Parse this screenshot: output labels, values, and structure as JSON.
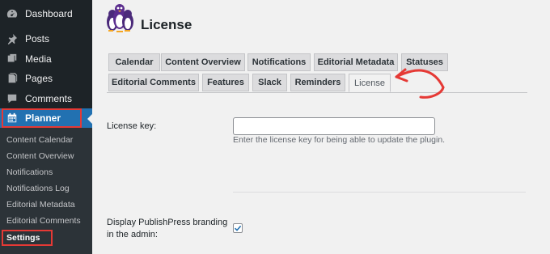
{
  "sidebar": {
    "menu": [
      {
        "label": "Dashboard",
        "icon": "dashboard-icon"
      },
      {
        "label": "Posts",
        "icon": "pin-icon"
      },
      {
        "label": "Media",
        "icon": "media-icon"
      },
      {
        "label": "Pages",
        "icon": "pages-icon"
      },
      {
        "label": "Comments",
        "icon": "comments-icon"
      },
      {
        "label": "Planner",
        "icon": "calendar-icon"
      }
    ],
    "submenu": [
      "Content Calendar",
      "Content Overview",
      "Notifications",
      "Notifications Log",
      "Editorial Metadata",
      "Editorial Comments",
      "Settings"
    ],
    "current_submenu": "Settings"
  },
  "header": {
    "title": "License",
    "logo_icon": "publishpress-penguins-logo"
  },
  "tabs": {
    "row1": [
      "Calendar",
      "Content Overview",
      "Notifications",
      "Editorial Metadata",
      "Statuses"
    ],
    "row2": [
      "Editorial Comments",
      "Features",
      "Slack",
      "Reminders",
      "License"
    ],
    "active": "License"
  },
  "form": {
    "license_label": "License key:",
    "license_value": "",
    "license_help": "Enter the license key for being able to update the plugin.",
    "branding_label": "Display PublishPress branding in the admin:",
    "branding_checked": true
  },
  "colors": {
    "sidebar_bg": "#1d2327",
    "submenu_bg": "#2c3338",
    "accent": "#2271b1",
    "annotation": "#e53935"
  }
}
